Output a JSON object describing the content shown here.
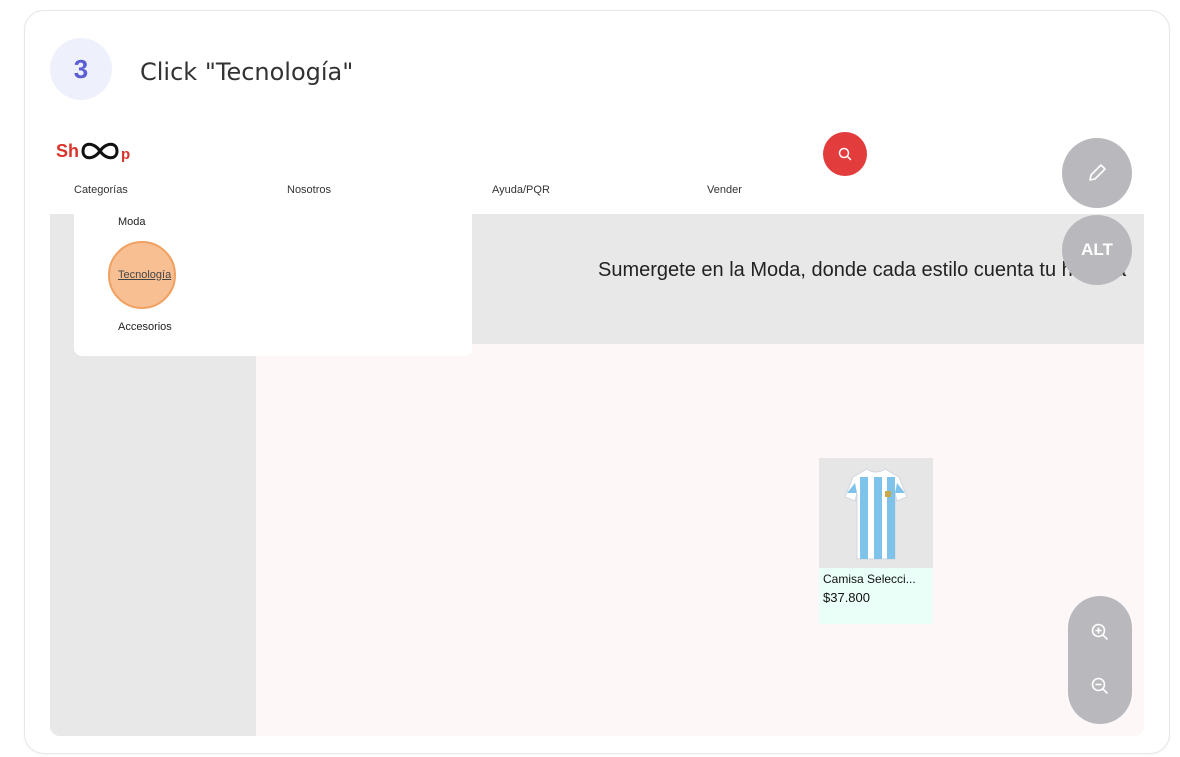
{
  "step": {
    "number": "3",
    "instruction": "Click \"Tecnología\""
  },
  "site": {
    "logo_left": "Sh",
    "logo_right": "p",
    "nav": [
      "Categorías",
      "Nosotros",
      "Ayuda/PQR",
      "Vender"
    ],
    "dropdown": [
      "Moda",
      "Tecnología",
      "Accesorios"
    ],
    "banner_text": "Sumergete en la Moda, donde cada estilo cuenta tu historia",
    "product": {
      "name": "Camisa Selecci...",
      "price": "$37.800"
    }
  },
  "overlay": {
    "alt_label": "ALT"
  },
  "colors": {
    "accent": "#5b5fd6",
    "brand_red": "#e23c3c",
    "highlight": "#f5aa6e"
  },
  "icons": [
    "search-icon",
    "pencil-icon",
    "zoom-in-icon",
    "zoom-out-icon"
  ]
}
